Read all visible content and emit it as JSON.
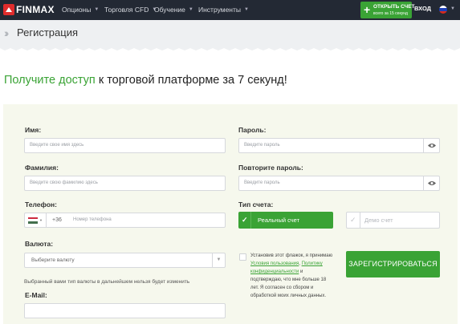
{
  "header": {
    "logo_text": "FINMAX",
    "nav": [
      {
        "label": "Опционы"
      },
      {
        "label": "Торговля CFD"
      },
      {
        "label": "Обучение"
      },
      {
        "label": "Инструменты"
      }
    ],
    "open_account": {
      "line1": "ОТКРЫТЬ СЧЕТ",
      "line2": "всего за 15 секунд"
    },
    "login_label": "ВХОД",
    "language_icon": "russian-flag-icon"
  },
  "breadcrumb": {
    "title": "Регистрация"
  },
  "headline": {
    "highlight": "Получите доступ",
    "rest": " к торговой платформе за 7 секунд!"
  },
  "form": {
    "name": {
      "label": "Имя:",
      "placeholder": "Введите свое имя здесь"
    },
    "surname": {
      "label": "Фамилия:",
      "placeholder": "Введите свою фамилию здесь"
    },
    "phone": {
      "label": "Телефон:",
      "code": "+36",
      "placeholder": "Номер телефона",
      "flag_icon": "hungary-flag-icon"
    },
    "currency": {
      "label": "Валюта:",
      "selected": "Выберите валюту"
    },
    "currency_note": "Выбранный вами тип валюты в дальнейшем нельзя будет изменить",
    "email": {
      "label": "E-Mail:"
    },
    "password": {
      "label": "Пароль:",
      "placeholder": "Введите пароль"
    },
    "password_repeat": {
      "label": "Повторите пароль:",
      "placeholder": "Введите пароль"
    },
    "account_type": {
      "label": "Тип счета:",
      "real": "Реальный счет",
      "demo": "Демо счет",
      "selected": "real"
    },
    "agreement": {
      "text1": "Установив этот флажок, я принимаю ",
      "link1": "Условия пользования",
      "text2": ", ",
      "link2": "Политику конфиденциальности",
      "text3": " и подтверждаю, что мне больше 18 лет. Я согласен со сбором и обработкой моих личных данных."
    },
    "submit_label": "ЗАРЕГИСТРИРОВАТЬСЯ"
  },
  "colors": {
    "accent_green": "#3aa335",
    "topbar": "#232934",
    "panel": "#f6f8ed",
    "breadcrumb_bg": "#eef0f2"
  }
}
